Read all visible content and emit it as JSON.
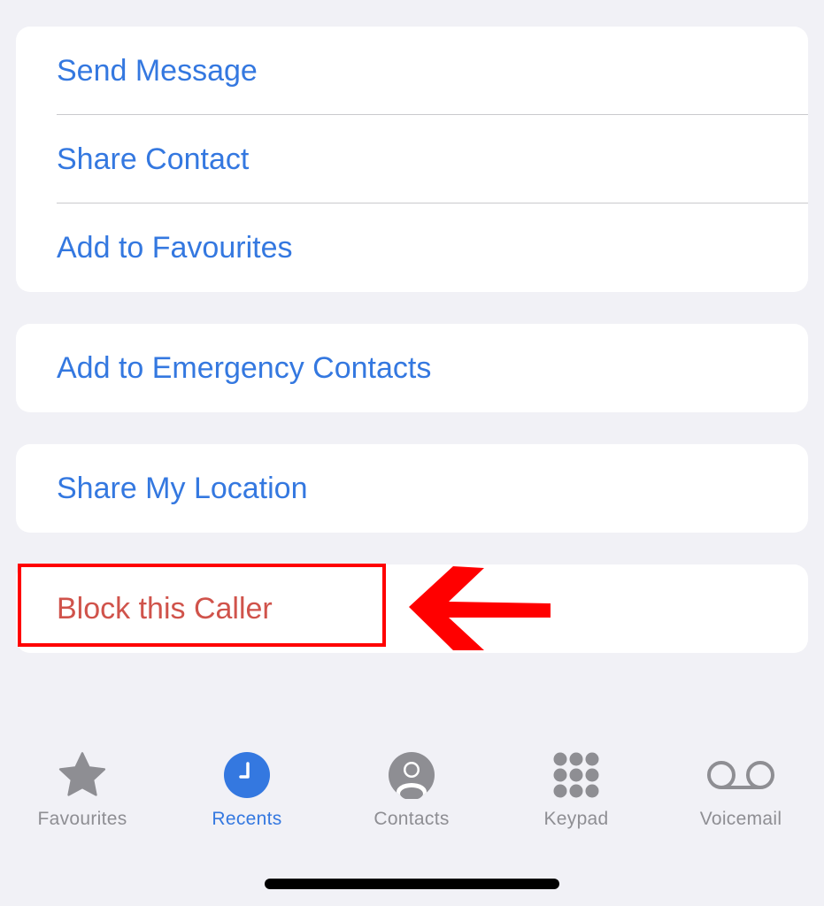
{
  "groups": [
    {
      "items": [
        {
          "label": "Send Message"
        },
        {
          "label": "Share Contact"
        },
        {
          "label": "Add to Favourites"
        }
      ]
    },
    {
      "items": [
        {
          "label": "Add to Emergency Contacts"
        }
      ]
    },
    {
      "items": [
        {
          "label": "Share My Location"
        }
      ]
    },
    {
      "items": [
        {
          "label": "Block this Caller",
          "style": "destructive"
        }
      ]
    }
  ],
  "annotation": {
    "highlight": "Block this Caller",
    "color": "#ff0000"
  },
  "colors": {
    "accent": "#3478e0",
    "destructive": "#d0534b",
    "inactive": "#8e8e93",
    "background": "#f1f1f6"
  },
  "tabbar": {
    "active": "Recents",
    "tabs": [
      {
        "label": "Favourites",
        "icon": "star-icon"
      },
      {
        "label": "Recents",
        "icon": "clock-icon"
      },
      {
        "label": "Contacts",
        "icon": "person-circle-icon"
      },
      {
        "label": "Keypad",
        "icon": "keypad-icon"
      },
      {
        "label": "Voicemail",
        "icon": "voicemail-icon"
      }
    ]
  }
}
